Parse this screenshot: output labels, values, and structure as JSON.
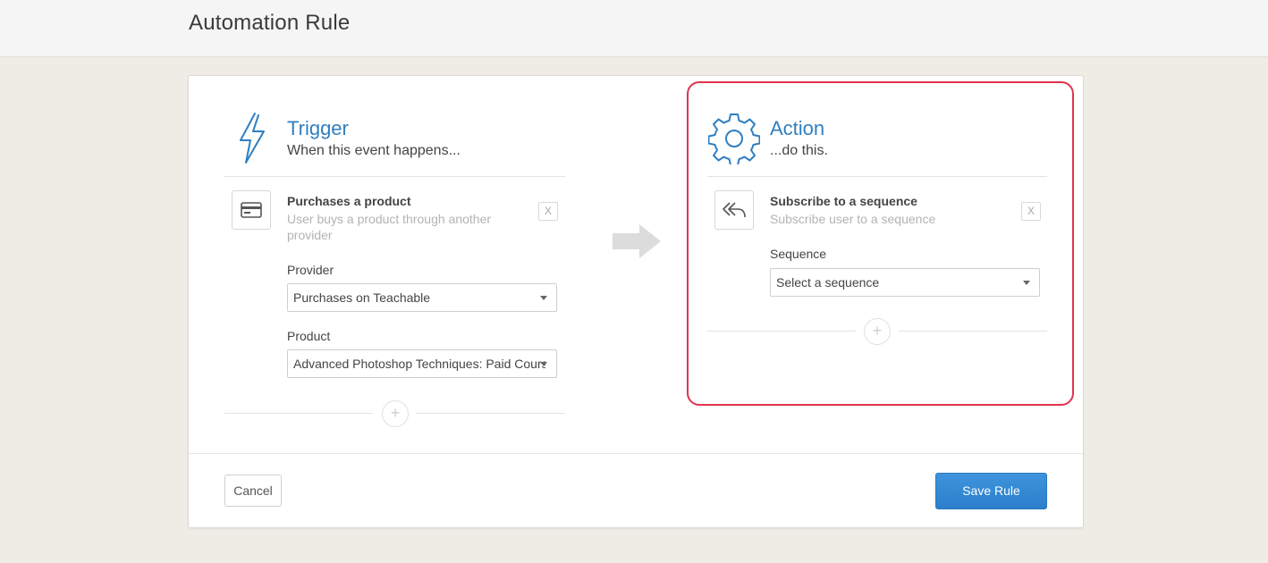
{
  "header": {
    "title": "Automation Rule"
  },
  "trigger": {
    "icon": "lightning-icon",
    "title": "Trigger",
    "subtitle": "When this event happens...",
    "item": {
      "icon": "credit-card-icon",
      "title": "Purchases a product",
      "description": "User buys a product through another provider",
      "remove_label": "X"
    },
    "fields": {
      "provider_label": "Provider",
      "provider_value": "Purchases on Teachable",
      "product_label": "Product",
      "product_value": "Advanced Photoshop Techniques: Paid Course"
    },
    "add_label": "+"
  },
  "flow_arrow": {
    "icon": "arrow-right-icon"
  },
  "action": {
    "icon": "gear-icon",
    "title": "Action",
    "subtitle": "...do this.",
    "item": {
      "icon": "reply-all-icon",
      "title": "Subscribe to a sequence",
      "description": "Subscribe user to a sequence",
      "remove_label": "X"
    },
    "fields": {
      "sequence_label": "Sequence",
      "sequence_value": "Select a sequence"
    },
    "add_label": "+",
    "highlight_color": "#e0344d"
  },
  "footer": {
    "cancel_label": "Cancel",
    "save_label": "Save Rule"
  },
  "colors": {
    "accent": "#2f7fc1",
    "primary_button": "#3188d4",
    "background": "#efece6"
  }
}
